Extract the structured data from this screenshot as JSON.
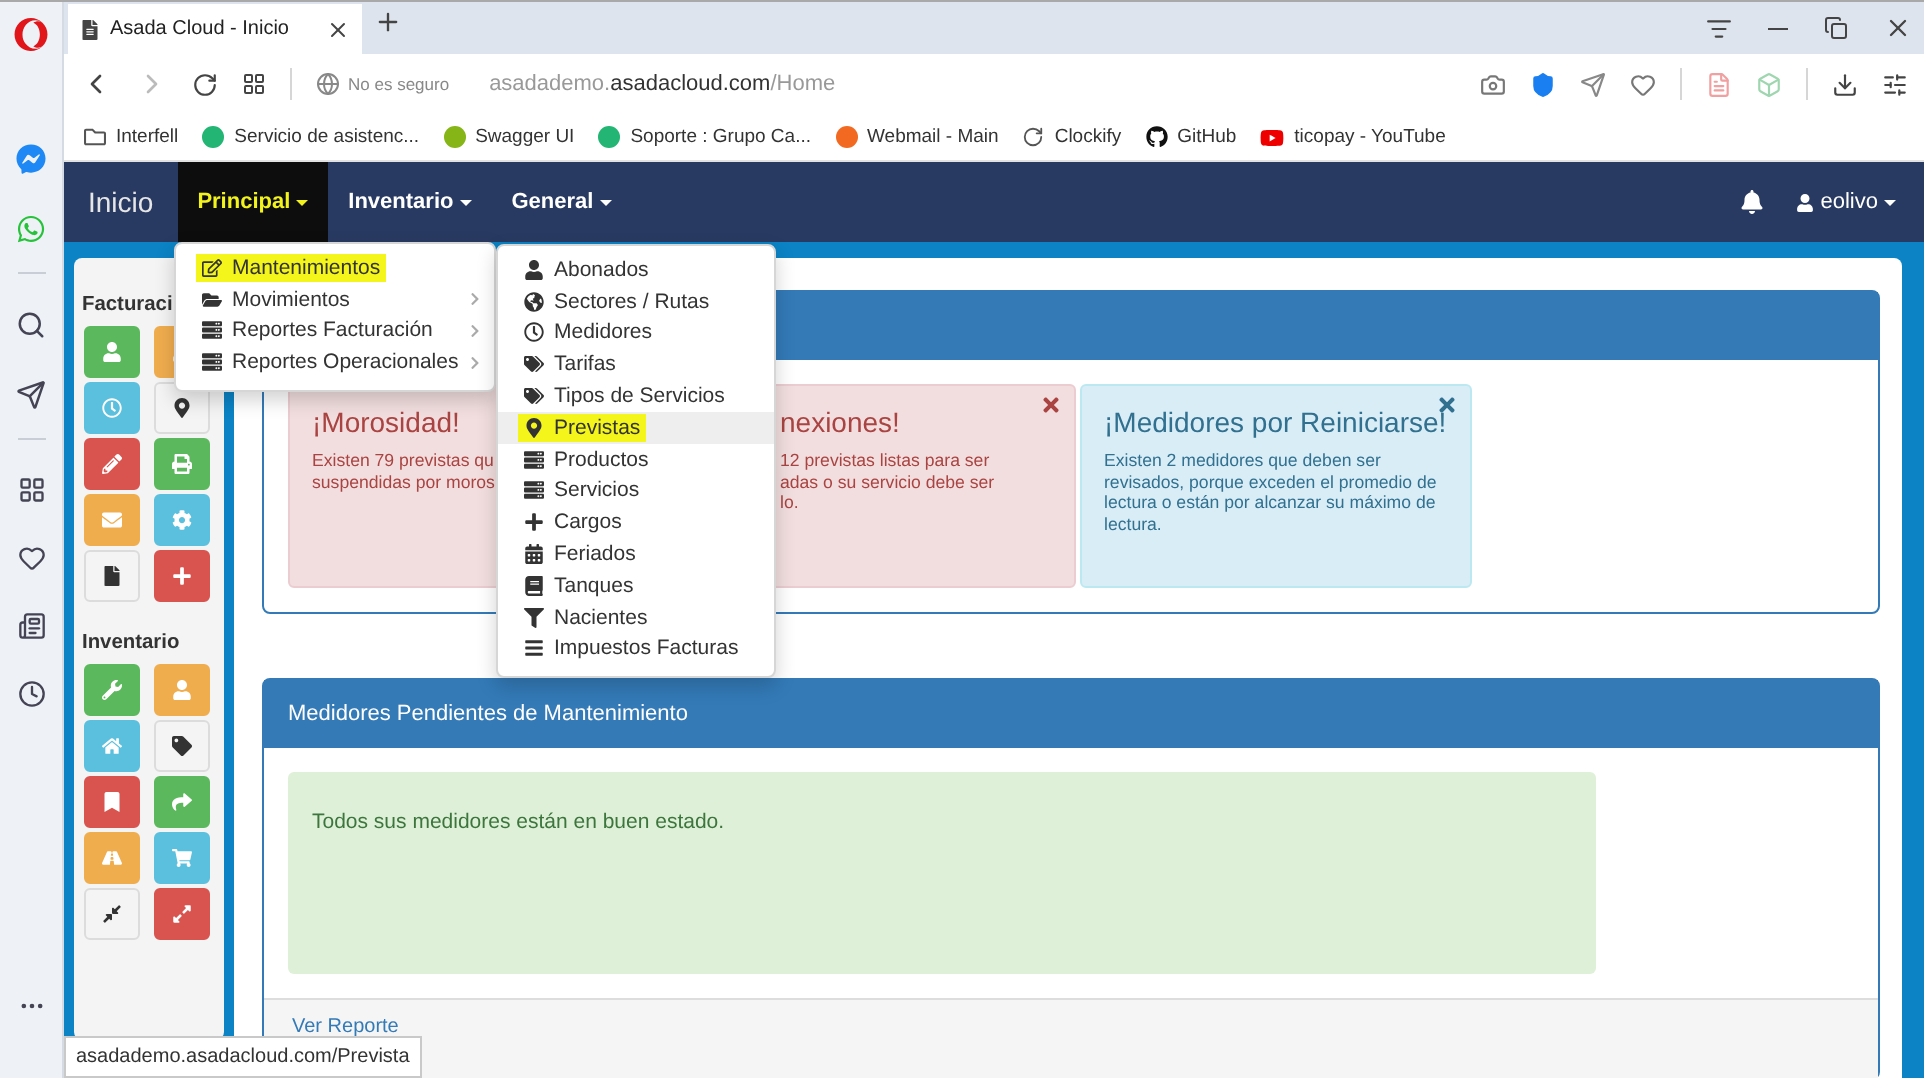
{
  "browser": {
    "tab_title": "Asada Cloud - Inicio",
    "security": "No es seguro",
    "url": {
      "subdomain": "asadademo.",
      "domain": "asadacloud.com",
      "path": "/Home"
    },
    "bookmarks": [
      {
        "label": "Interfell"
      },
      {
        "label": "Servicio de asistenc..."
      },
      {
        "label": "Swagger UI"
      },
      {
        "label": "Soporte : Grupo Ca..."
      },
      {
        "label": "Webmail - Main"
      },
      {
        "label": "Clockify"
      },
      {
        "label": "GitHub"
      },
      {
        "label": "ticopay - YouTube"
      }
    ],
    "status_url": "asadademo.asadacloud.com/Prevista"
  },
  "navbar": {
    "brand": "Inicio",
    "items": [
      {
        "label": "Principal",
        "selected": true
      },
      {
        "label": "Inventario",
        "selected": false
      },
      {
        "label": "General",
        "selected": false
      }
    ],
    "user": "eolivo"
  },
  "menu": {
    "items": [
      {
        "label": "Mantenimientos",
        "highlighted": true,
        "submenu": false
      },
      {
        "label": "Movimientos",
        "highlighted": false,
        "submenu": true
      },
      {
        "label": "Reportes Facturación",
        "highlighted": false,
        "submenu": true
      },
      {
        "label": "Reportes Operacionales",
        "highlighted": false,
        "submenu": true
      }
    ]
  },
  "submenu": {
    "items": [
      {
        "label": "Abonados",
        "highlighted": false,
        "selected": false
      },
      {
        "label": "Sectores / Rutas",
        "highlighted": false,
        "selected": false
      },
      {
        "label": "Medidores",
        "highlighted": false,
        "selected": false
      },
      {
        "label": "Tarifas",
        "highlighted": false,
        "selected": false
      },
      {
        "label": "Tipos de Servicios",
        "highlighted": false,
        "selected": false
      },
      {
        "label": "Previstas",
        "highlighted": true,
        "selected": true
      },
      {
        "label": "Productos",
        "highlighted": false,
        "selected": false
      },
      {
        "label": "Servicios",
        "highlighted": false,
        "selected": false
      },
      {
        "label": "Cargos",
        "highlighted": false,
        "selected": false
      },
      {
        "label": "Feriados",
        "highlighted": false,
        "selected": false
      },
      {
        "label": "Tanques",
        "highlighted": false,
        "selected": false
      },
      {
        "label": "Nacientes",
        "highlighted": false,
        "selected": false
      },
      {
        "label": "Impuestos Facturas",
        "highlighted": false,
        "selected": false
      }
    ]
  },
  "sidebar": {
    "groups": [
      {
        "title": "Facturaci",
        "buttons": [
          {
            "color": "#5cb85c"
          },
          {
            "color": "#f0ad4e"
          },
          {
            "color": "#5bc0de"
          },
          {
            "color": "#f4f4f4"
          },
          {
            "color": "#d9534f"
          },
          {
            "color": "#5cb85c"
          },
          {
            "color": "#f0ad4e"
          },
          {
            "color": "#5bc0de"
          },
          {
            "color": "#f4f4f4"
          },
          {
            "color": "#d9534f"
          }
        ]
      },
      {
        "title": "Inventario",
        "buttons": [
          {
            "color": "#5cb85c"
          },
          {
            "color": "#f0ad4e"
          },
          {
            "color": "#5bc0de"
          },
          {
            "color": "#f4f4f4"
          },
          {
            "color": "#d9534f"
          },
          {
            "color": "#5cb85c"
          },
          {
            "color": "#f0ad4e"
          },
          {
            "color": "#5bc0de"
          },
          {
            "color": "#f4f4f4"
          },
          {
            "color": "#d9534f"
          }
        ]
      }
    ]
  },
  "alerts_panel": {
    "alerts": [
      {
        "kind": "danger",
        "title": "¡Morosidad!",
        "lines": [
          "Existen 79 previstas qu",
          "suspendidas por moros"
        ],
        "closable": false
      },
      {
        "kind": "danger",
        "title": "nexiones!",
        "lines": [
          "12 previstas listas para ser",
          "adas o su servicio debe ser",
          "lo."
        ],
        "closable": true
      },
      {
        "kind": "info",
        "title": "¡Medidores por Reiniciarse!",
        "lines": [
          "Existen 2 medidores que deben ser",
          "revisados, porque exceden el promedio de",
          "lectura o están por alcanzar su máximo de",
          "lectura."
        ],
        "closable": true
      }
    ]
  },
  "maintenance_panel": {
    "title": "Medidores Pendientes de Mantenimiento",
    "message": "Todos sus medidores están en buen estado.",
    "footer_link": "Ver Reporte"
  }
}
